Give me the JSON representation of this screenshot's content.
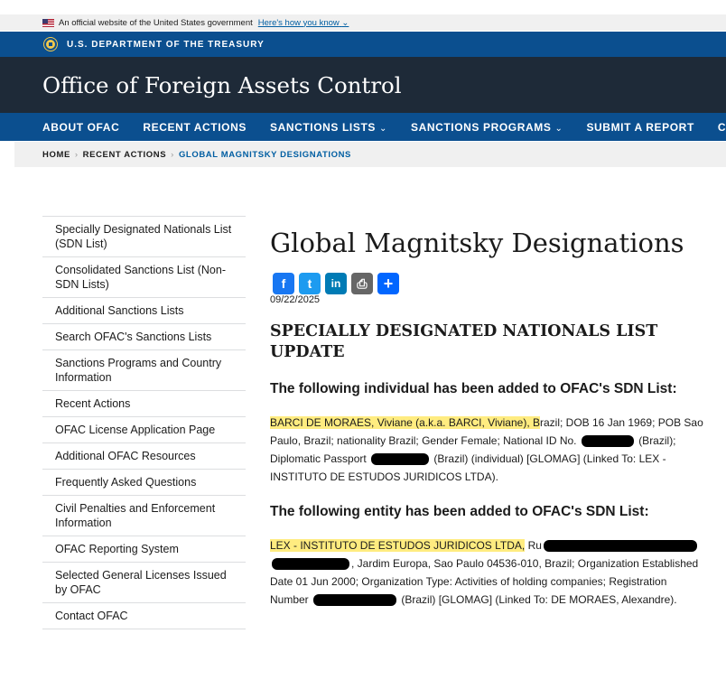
{
  "gov_banner": {
    "text": "An official website of the United States government",
    "link": "Here's how you know",
    "link_chevron": "⌄"
  },
  "agency": {
    "name": "U.S. DEPARTMENT OF THE TREASURY"
  },
  "site": {
    "title": "Office of Foreign Assets Control"
  },
  "nav": {
    "items": [
      {
        "label": "ABOUT OFAC",
        "chevron": ""
      },
      {
        "label": "RECENT ACTIONS",
        "chevron": ""
      },
      {
        "label": "SANCTIONS LISTS",
        "chevron": "⌄"
      },
      {
        "label": "SANCTIONS PROGRAMS",
        "chevron": "⌄"
      },
      {
        "label": "SUBMIT A REPORT",
        "chevron": ""
      },
      {
        "label": "CONTACT",
        "chevron": ""
      }
    ]
  },
  "breadcrumb": {
    "items": [
      "HOME",
      "RECENT ACTIONS",
      "GLOBAL MAGNITSKY DESIGNATIONS"
    ],
    "separator": "›"
  },
  "sidebar": {
    "items": [
      "Specially Designated Nationals List (SDN List)",
      "Consolidated Sanctions List (Non-SDN Lists)",
      "Additional Sanctions Lists",
      "Search OFAC's Sanctions Lists",
      "Sanctions Programs and Country Information",
      "Recent Actions",
      "OFAC License Application Page",
      "Additional OFAC Resources",
      "Frequently Asked Questions",
      "Civil Penalties and Enforcement Information",
      "OFAC Reporting System",
      "Selected General Licenses Issued by OFAC",
      "Contact OFAC"
    ]
  },
  "share": {
    "icons": [
      {
        "name": "facebook-icon",
        "glyph": "f",
        "color": "#1877f2"
      },
      {
        "name": "twitter-icon",
        "glyph": "t",
        "color": "#1d9bf0"
      },
      {
        "name": "linkedin-icon",
        "glyph": "in",
        "color": "#007bb5"
      },
      {
        "name": "print-icon",
        "glyph": "⎙",
        "color": "#666666"
      },
      {
        "name": "share-plus-icon",
        "glyph": "+",
        "color": "#0166ff"
      }
    ]
  },
  "content": {
    "title": "Global Magnitsky Designations",
    "date": "09/22/2025",
    "section_title": "SPECIALLY DESIGNATED NATIONALS LIST UPDATE",
    "individual_heading": "The following individual has been added to OFAC's SDN List:",
    "individual": {
      "highlight": "BARCI DE MORAES, Viviane (a.k.a. BARCI, Viviane), B",
      "part1": "razil; DOB 16 Jan 1969; POB Sao Paulo, Brazil; nationality Brazil; Gender Female; National ID No.",
      "part2": "(Brazil); Diplomatic Passport",
      "part3": "(Brazil) (individual) [GLOMAG] (Linked To: LEX - INSTITUTO DE ESTUDOS JURIDICOS LTDA)."
    },
    "entity_heading": "The following entity has been added to OFAC's SDN List:",
    "entity": {
      "highlight": "LEX - INSTITUTO DE ESTUDOS JURIDICOS LTDA,",
      "part1": " Ru",
      "part2": ", Jardim Europa, Sao Paulo 04536-010, Brazil; Organization Established Date 01 Jun 2000; Organization Type: Activities of holding companies; Registration Number",
      "part3": "(Brazil) [GLOMAG] (Linked To: DE MORAES, Alexandre)."
    }
  },
  "colors": {
    "treasury_blue": "#0b4f8f",
    "title_bar": "#1e2a38",
    "highlight": "#ffec80",
    "link": "#005ea2"
  }
}
